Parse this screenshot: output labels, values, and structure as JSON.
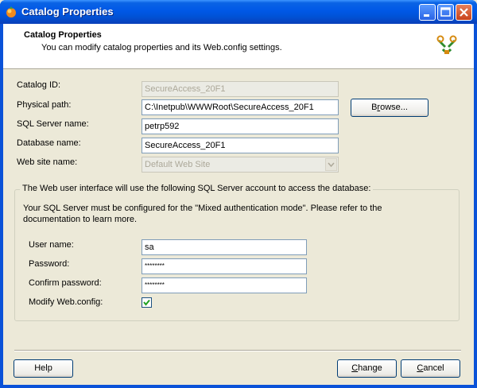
{
  "window": {
    "title": "Catalog Properties"
  },
  "header": {
    "title": "Catalog Properties",
    "subtitle": "You can modify catalog properties and its Web.config settings."
  },
  "fields": {
    "catalog_id": {
      "label": "Catalog ID:",
      "value": "SecureAccess_20F1"
    },
    "physical_path": {
      "label": "Physical path:",
      "value": "C:\\Inetpub\\WWWRoot\\SecureAccess_20F1"
    },
    "sql_server": {
      "label": "SQL Server name:",
      "value": "petrp592"
    },
    "database": {
      "label": "Database name:",
      "value": "SecureAccess_20F1"
    },
    "web_site": {
      "label": "Web site name:",
      "value": "Default Web Site"
    }
  },
  "browse_button": {
    "label_pre": "B",
    "label_u": "r",
    "label_post": "owse..."
  },
  "sql_account": {
    "caption": "The Web user interface will use the following SQL Server account to access the database:",
    "note": "Your SQL Server must be configured for the \"Mixed authentication mode\". Please refer to the documentation to learn more.",
    "user_name": {
      "label": "User name:",
      "value": "sa"
    },
    "password": {
      "label": "Password:",
      "value": "********"
    },
    "confirm_password": {
      "label": "Confirm password:",
      "value": "********"
    },
    "modify_web_config": {
      "label": "Modify Web.config:",
      "checked": true
    }
  },
  "footer": {
    "help": "Help",
    "change_pre": "",
    "change_u": "C",
    "change_post": "hange",
    "cancel_pre": "",
    "cancel_u": "C",
    "cancel_post": "ancel"
  },
  "colors": {
    "title_bar": "#0058e6",
    "dialog_bg": "#ece9d8"
  }
}
